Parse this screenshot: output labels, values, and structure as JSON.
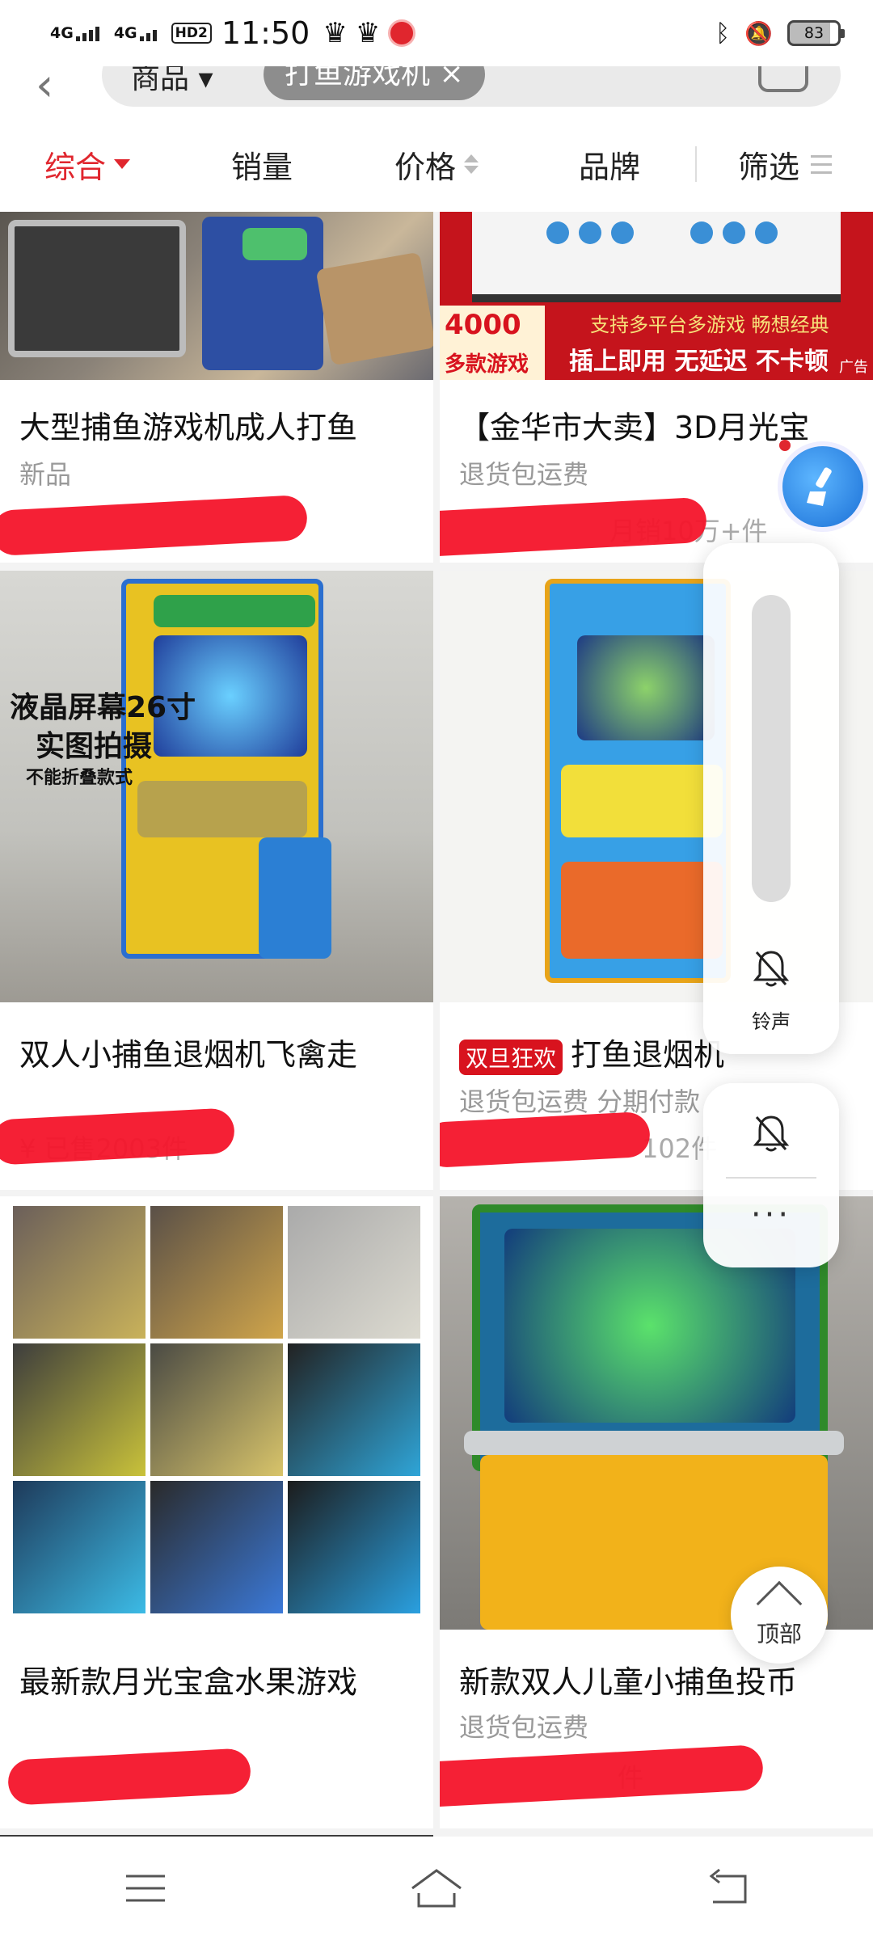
{
  "status_bar": {
    "network1": "4G",
    "network2": "4G",
    "hd_badge": "HD2",
    "time": "11:50",
    "battery": "83"
  },
  "search": {
    "scope": "商品 ▾",
    "query_tag": "打鱼游戏机 ×"
  },
  "sort_tabs": [
    {
      "label": "综合",
      "active": true
    },
    {
      "label": "销量"
    },
    {
      "label": "价格"
    },
    {
      "label": "品牌"
    },
    {
      "label": "筛选"
    }
  ],
  "products": [
    {
      "title": "大型捕鱼游戏机成人打鱼",
      "subtitle": "新品",
      "meta": ""
    },
    {
      "title": "【金华市大卖】3D月光宝",
      "subtitle": "退货包运费",
      "meta": "月销10万+件",
      "banner": {
        "count": "4000",
        "count_label": "多款游戏",
        "line1": "支持多平台多游戏 畅想经典",
        "line2": "插上即用 无延迟 不卡顿",
        "ad": "广告"
      }
    },
    {
      "title": "双人小捕鱼退烟机飞禽走",
      "subtitle": "",
      "meta": "¥ 已售2003件",
      "overlay": {
        "line1": "液晶屏幕26寸",
        "line2": "实图拍摄",
        "line3": "不能折叠款式"
      }
    },
    {
      "title": "打鱼退烟机",
      "badge": "双旦狂欢",
      "subtitle": "退货包运费  分期付款",
      "meta": "102件"
    },
    {
      "title": "最新款月光宝盒水果游戏",
      "subtitle": "",
      "meta": ""
    },
    {
      "title": "新款双人儿童小捕鱼投币",
      "subtitle": "退货包运费",
      "meta": "件"
    }
  ],
  "floating": {
    "volume_label": "铃声",
    "more": "···",
    "to_top": "顶部"
  },
  "colors": {
    "accent": "#e0262e",
    "scribble": "#f4142a"
  }
}
